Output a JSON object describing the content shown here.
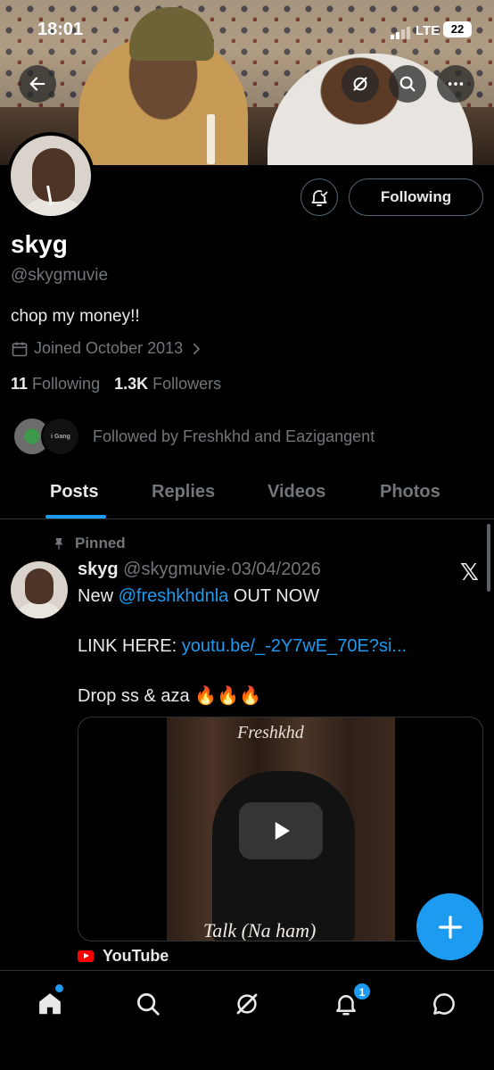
{
  "status_bar": {
    "time": "18:01",
    "network": "LTE",
    "battery": "22"
  },
  "profile": {
    "name": "skyg",
    "handle": "@skygmuvie",
    "bio": "chop my money!!",
    "joined": "Joined October 2013",
    "following_count": "11",
    "following_label": "Following",
    "followers_count": "1.3K",
    "followers_label": "Followers",
    "followed_by": "Followed by Freshkhd and Eazigangent",
    "follow_button": "Following"
  },
  "tabs": [
    {
      "label": "Posts",
      "active": true
    },
    {
      "label": "Replies",
      "active": false
    },
    {
      "label": "Videos",
      "active": false
    },
    {
      "label": "Photos",
      "active": false
    }
  ],
  "post": {
    "pinned_label": "Pinned",
    "author_name": "skyg",
    "author_handle": "@skygmuvie",
    "separator": "·",
    "date": "03/04/2026",
    "line1_prefix": "New ",
    "line1_mention": "@freshkhdnla",
    "line1_suffix": " OUT NOW",
    "line2_prefix": "LINK HERE: ",
    "line2_link": "youtu.be/_-2Y7wE_70E?si...",
    "line3": "Drop ss & aza 🔥🔥🔥",
    "media_title_top": "Freshkhd",
    "media_title_bottom": "Talk (Na ham)",
    "source": "YouTube"
  },
  "mini_avatar_text": "i Gang",
  "notifications_badge": "1",
  "icons": [
    "back-icon",
    "grok-icon",
    "search-icon",
    "more-icon",
    "bell-plus-icon",
    "calendar-icon",
    "chevron-right-icon",
    "pin-icon",
    "x-logo-icon",
    "play-icon",
    "youtube-icon",
    "plus-icon",
    "home-icon",
    "search-nav-icon",
    "grok-nav-icon",
    "notifications-icon",
    "messages-icon"
  ],
  "colors": {
    "accent": "#1d9bf0",
    "background": "#000000",
    "muted": "#71767b",
    "text": "#e7e9ea"
  }
}
